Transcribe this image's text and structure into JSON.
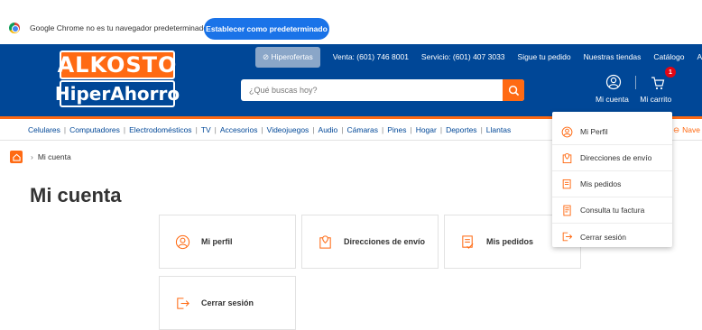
{
  "infobar": {
    "message": "Google Chrome no es tu navegador predeterminado",
    "button": "Establecer como predeterminado"
  },
  "header": {
    "logo_top": "ALKOSTO",
    "logo_bottom": "HiperAhorro",
    "links": [
      "Hiperofertas",
      "Venta: (601) 746 8001",
      "Servicio: (601) 407 3033",
      "Sigue tu pedido",
      "Nuestras tiendas",
      "Catálogo",
      "A"
    ],
    "search_placeholder": "¿Qué buscas hoy?",
    "account_label": "Mi cuenta",
    "cart_label": "Mi carrito",
    "cart_count": "1"
  },
  "categories": [
    "Celulares",
    "Computadores",
    "Electrodomésticos",
    "TV",
    "Accesorios",
    "Videojuegos",
    "Audio",
    "Cámaras",
    "Pines",
    "Hogar",
    "Deportes",
    "Llantas"
  ],
  "nav_right_label": "Nave",
  "breadcrumb": {
    "current": "Mi cuenta"
  },
  "page_title": "Mi cuenta",
  "cards": [
    {
      "label": "Mi perfil",
      "icon": "user-icon"
    },
    {
      "label": "Direcciones de envío",
      "icon": "location-icon"
    },
    {
      "label": "Mis pedidos",
      "icon": "orders-icon"
    },
    {
      "label": "Cerrar sesión",
      "icon": "logout-icon"
    }
  ],
  "dropdown": [
    {
      "label": "Mi Perfil",
      "icon": "user-icon"
    },
    {
      "label": "Direcciones de envío",
      "icon": "location-icon"
    },
    {
      "label": "Mis pedidos",
      "icon": "orders-icon"
    },
    {
      "label": "Consulta tu factura",
      "icon": "invoice-icon"
    },
    {
      "label": "Cerrar sesión",
      "icon": "logout-icon"
    }
  ],
  "colors": {
    "brand_blue": "#004797",
    "brand_orange": "#ff6a13",
    "chrome_blue": "#1a73e8"
  }
}
